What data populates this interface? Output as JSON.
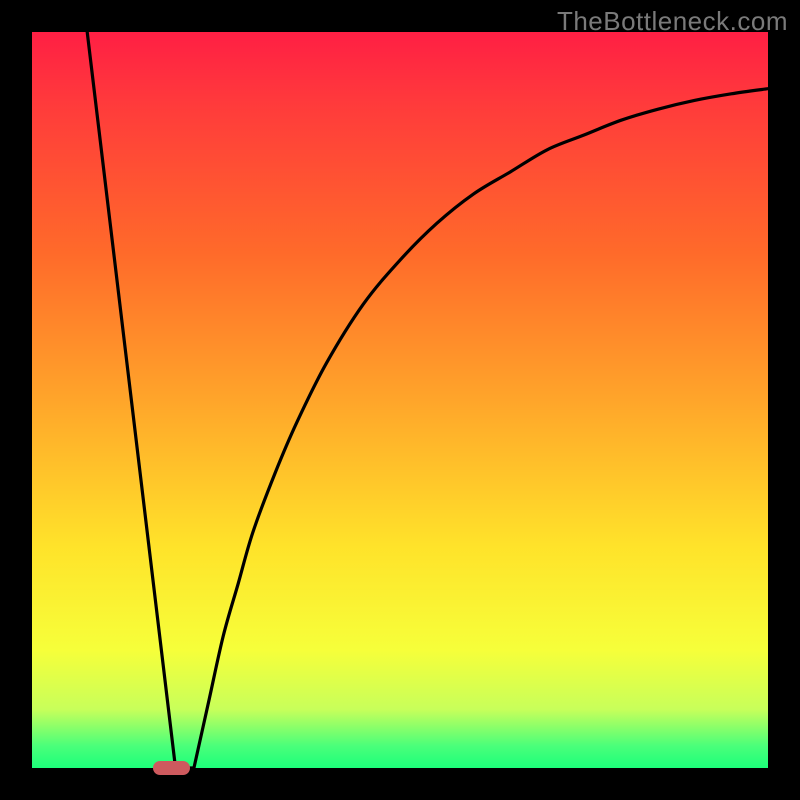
{
  "watermark": "TheBottleneck.com",
  "colors": {
    "frame": "#000000",
    "curve": "#000000",
    "marker": "#ce5a5e"
  },
  "chart_data": {
    "type": "line",
    "title": "",
    "xlabel": "",
    "ylabel": "",
    "xlim": [
      0,
      100
    ],
    "ylim": [
      0,
      100
    ],
    "series": [
      {
        "name": "left-line",
        "x": [
          7.5,
          19.5
        ],
        "y": [
          100,
          0
        ]
      },
      {
        "name": "right-curve",
        "x": [
          22,
          24,
          26,
          28,
          30,
          33,
          36,
          40,
          45,
          50,
          55,
          60,
          65,
          70,
          75,
          80,
          85,
          90,
          95,
          100
        ],
        "y": [
          0,
          9,
          18,
          25,
          32,
          40,
          47,
          55,
          63,
          69,
          74,
          78,
          81,
          84,
          86,
          88,
          89.5,
          90.7,
          91.6,
          92.3
        ]
      }
    ],
    "annotations": [
      {
        "type": "marker",
        "shape": "pill",
        "x": 19,
        "y": 0,
        "width_pct": 5,
        "height_pct": 2,
        "color": "#ce5a5e"
      }
    ]
  }
}
